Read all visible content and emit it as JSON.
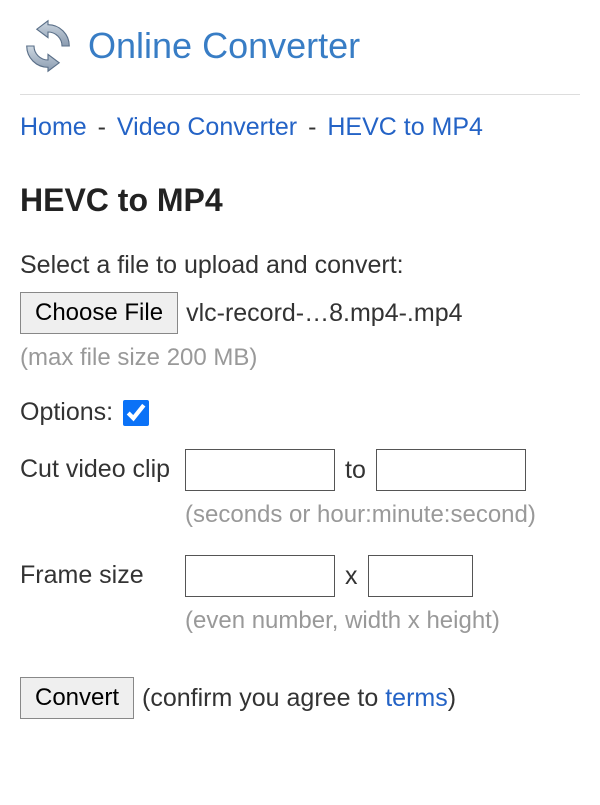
{
  "brand": {
    "name": "Online Converter",
    "icon": "refresh-icon"
  },
  "breadcrumb": {
    "items": [
      "Home",
      "Video Converter",
      "HEVC to MP4"
    ],
    "separator": "-"
  },
  "page_title": "HEVC to MP4",
  "file_section": {
    "instruction": "Select a file to upload and convert:",
    "choose_button": "Choose File",
    "selected_file": "vlc-record-…8.mp4-.mp4",
    "max_size_hint": "(max file size 200 MB)"
  },
  "options": {
    "label": "Options:",
    "checked": true,
    "cut": {
      "label": "Cut video clip",
      "from_value": "",
      "to_value": "",
      "joiner": "to",
      "hint": "(seconds or hour:minute:second)"
    },
    "frame": {
      "label": "Frame size",
      "width_value": "",
      "height_value": "",
      "joiner": "x",
      "hint": "(even number, width x height)"
    }
  },
  "convert": {
    "button": "Convert",
    "confirm_prefix": "(confirm you agree to ",
    "terms_link": "terms",
    "confirm_suffix": ")"
  }
}
